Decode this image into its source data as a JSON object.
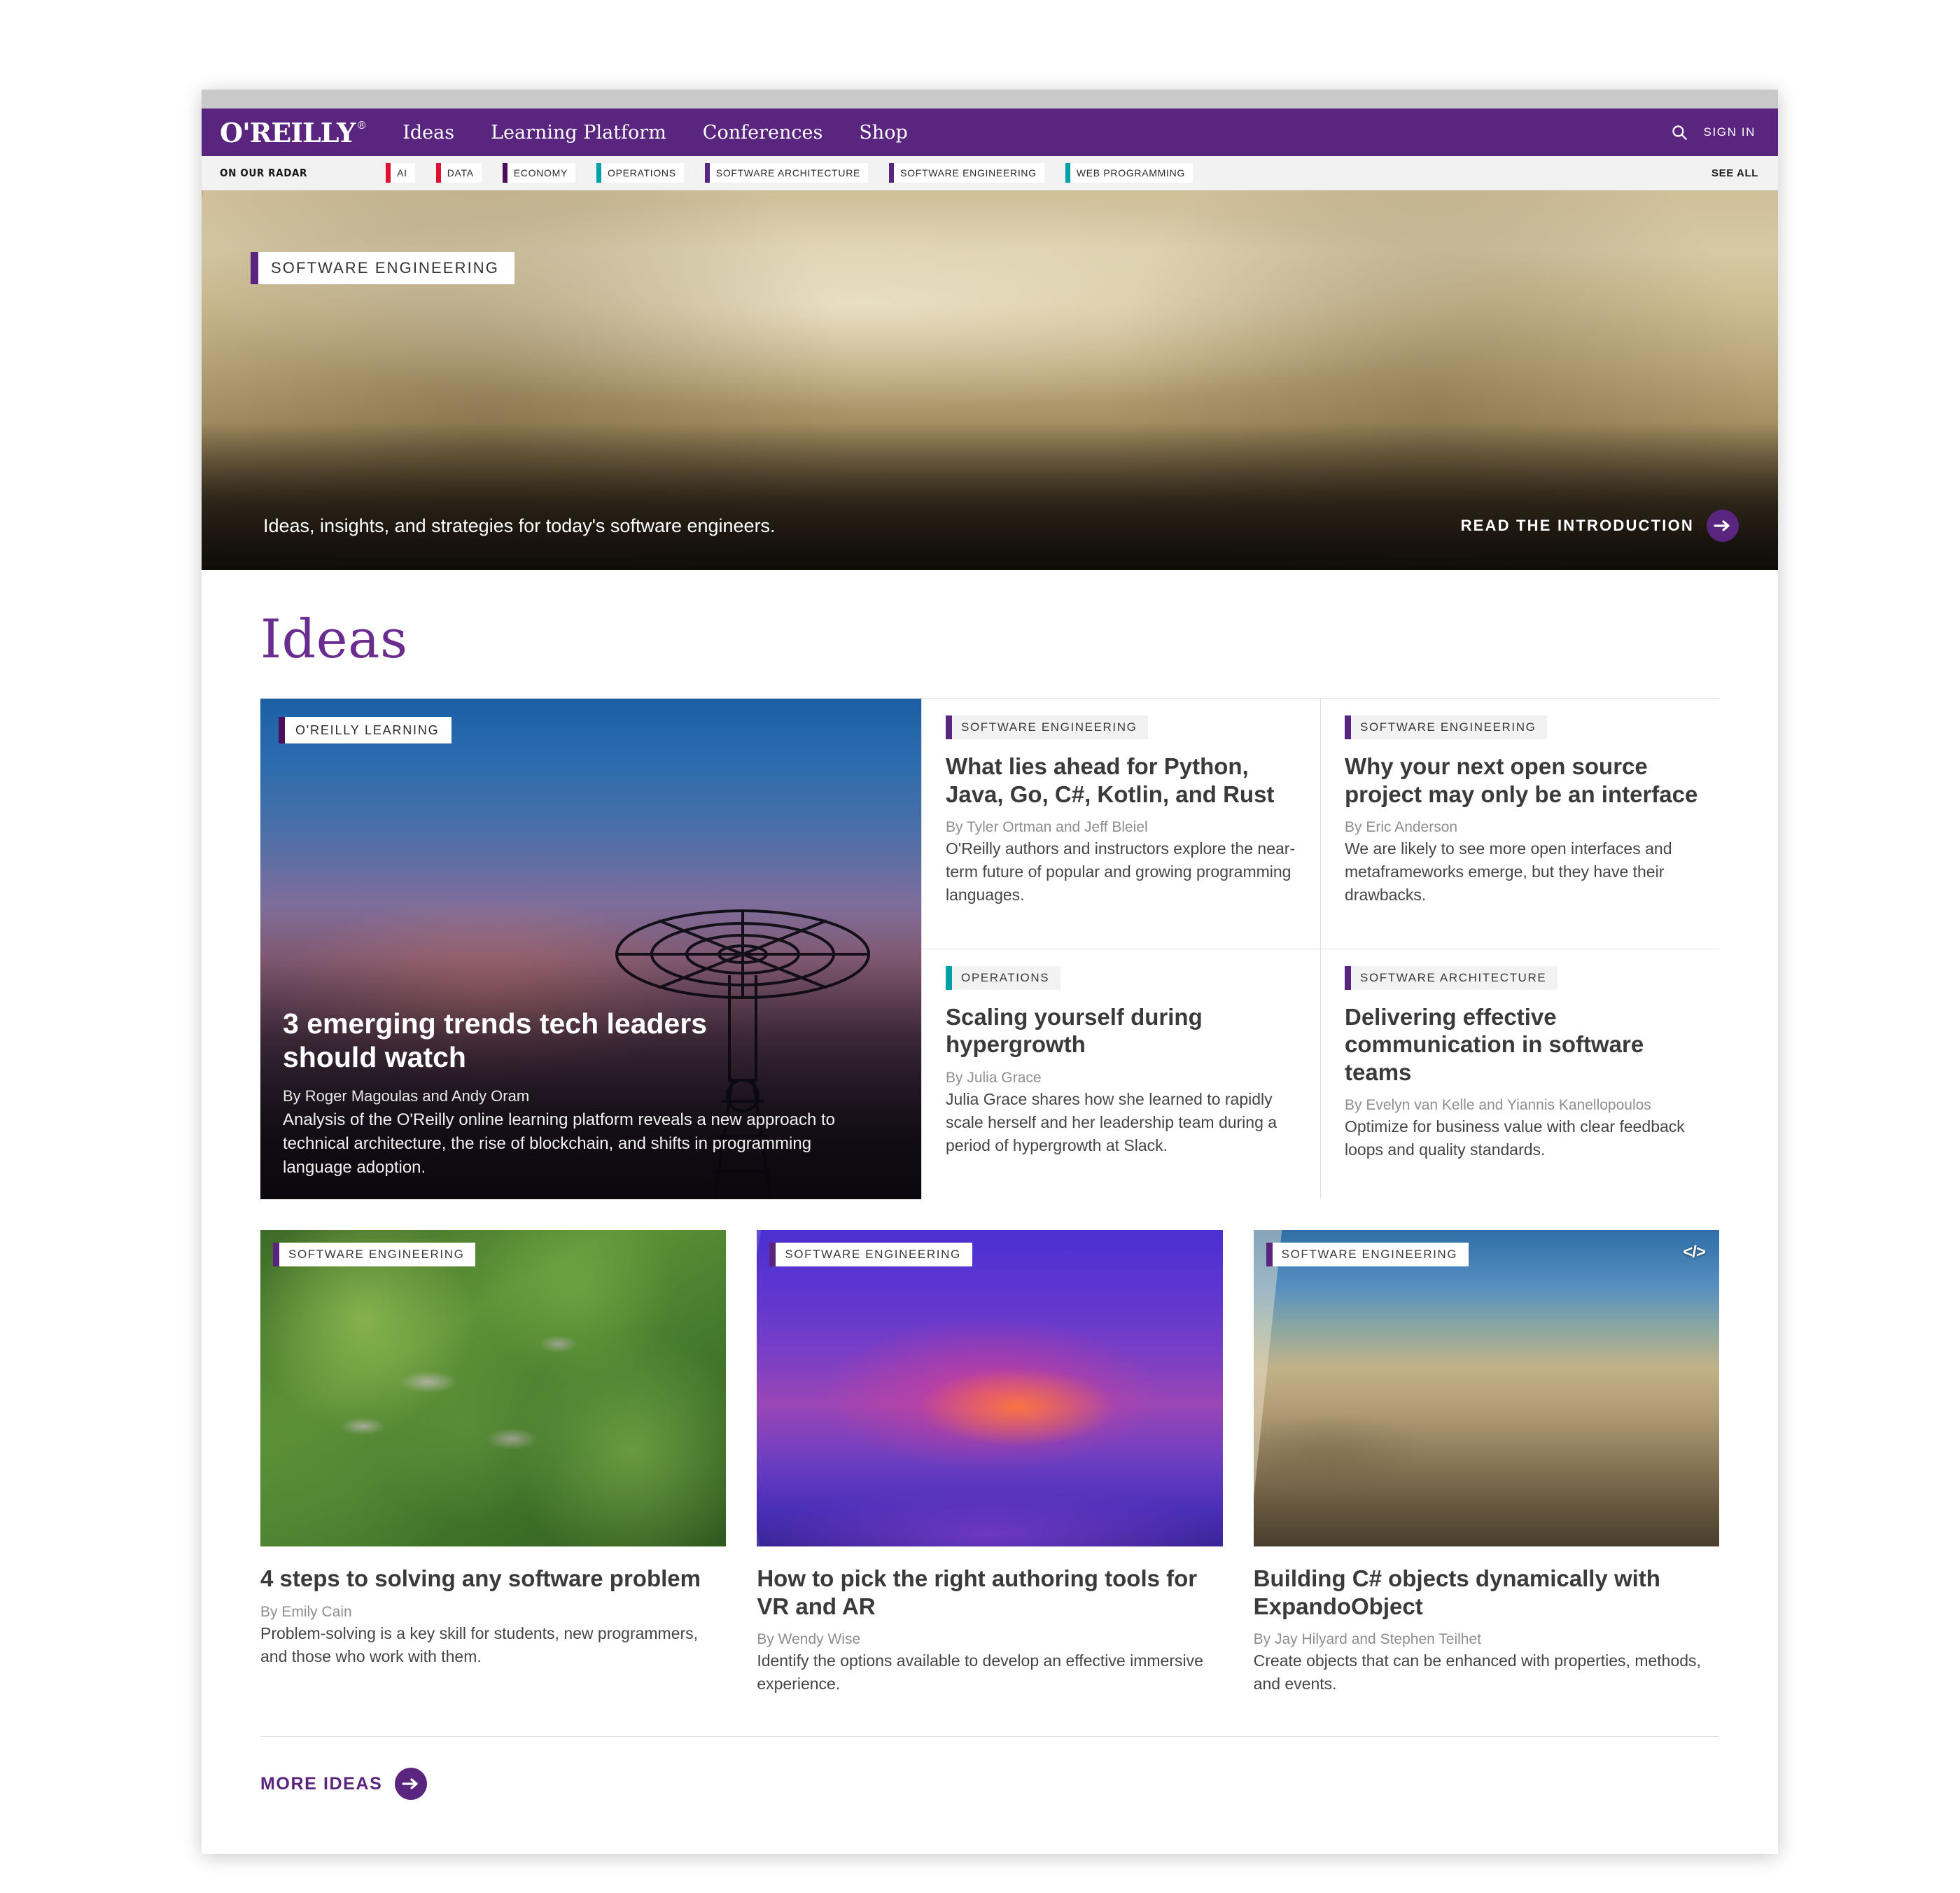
{
  "colors": {
    "brand_purple": "#59257f",
    "tag_ai": "#e01030",
    "tag_data": "#e01030",
    "tag_economy": "#4b1059",
    "tag_operations": "#00a0a8",
    "tag_software_architecture": "#59257f",
    "tag_software_engineering": "#59257f",
    "tag_web_programming": "#00a0a8"
  },
  "nav": {
    "brand": "O'REILLY",
    "brand_reg": "®",
    "links": [
      {
        "label": "Ideas"
      },
      {
        "label": "Learning Platform"
      },
      {
        "label": "Conferences"
      },
      {
        "label": "Shop"
      }
    ],
    "search_icon": "search-icon",
    "signin": "SIGN IN"
  },
  "radar": {
    "label": "ON OUR RADAR",
    "see_all": "SEE ALL",
    "items": [
      {
        "label": "AI",
        "color": "#e01030"
      },
      {
        "label": "DATA",
        "color": "#e01030"
      },
      {
        "label": "ECONOMY",
        "color": "#4b1059"
      },
      {
        "label": "OPERATIONS",
        "color": "#00a0a8"
      },
      {
        "label": "SOFTWARE ARCHITECTURE",
        "color": "#59257f"
      },
      {
        "label": "SOFTWARE ENGINEERING",
        "color": "#59257f"
      },
      {
        "label": "WEB PROGRAMMING",
        "color": "#00a0a8"
      }
    ]
  },
  "hero": {
    "tag": "SOFTWARE ENGINEERING",
    "tag_color": "#59257f",
    "subtitle": "Ideas, insights, and strategies for today's software engineers.",
    "cta": "READ THE INTRODUCTION"
  },
  "main": {
    "title": "Ideas",
    "feature": {
      "tag": "O'REILLY LEARNING",
      "tag_color": "#4b1059",
      "title": "3 emerging trends tech leaders should watch",
      "byline": "By Roger Magoulas and Andy Oram",
      "description": "Analysis of the O'Reilly online learning platform reveals a new approach to technical architecture, the rise of blockchain, and shifts in programming language adoption."
    },
    "mini_cards": [
      {
        "tag": "SOFTWARE ENGINEERING",
        "tag_color": "#59257f",
        "title": "What lies ahead for Python, Java, Go, C#, Kotlin, and Rust",
        "byline": "By Tyler Ortman and Jeff Bleiel",
        "description": "O'Reilly authors and instructors explore the near-term future of popular and growing programming languages."
      },
      {
        "tag": "SOFTWARE ENGINEERING",
        "tag_color": "#59257f",
        "title": "Why your next open source project may only be an interface",
        "byline": "By Eric Anderson",
        "description": "We are likely to see more open interfaces and metaframeworks emerge, but they have their drawbacks."
      },
      {
        "tag": "OPERATIONS",
        "tag_color": "#00a0a8",
        "title": "Scaling yourself during hypergrowth",
        "byline": "By Julia Grace",
        "description": "Julia Grace shares how she learned to rapidly scale herself and her leadership team during a period of hypergrowth at Slack."
      },
      {
        "tag": "SOFTWARE ARCHITECTURE",
        "tag_color": "#59257f",
        "title": "Delivering effective communication in software teams",
        "byline": "By Evelyn van Kelle and Yiannis Kanellopoulos",
        "description": "Optimize for business value with clear feedback loops and quality standards."
      }
    ],
    "bottom_cards": [
      {
        "tag": "SOFTWARE ENGINEERING",
        "tag_color": "#59257f",
        "title": "4 steps to solving any software problem",
        "byline": "By Emily Cain",
        "description": "Problem-solving is a key skill for students, new programmers, and those who work with them.",
        "code_badge": ""
      },
      {
        "tag": "SOFTWARE ENGINEERING",
        "tag_color": "#59257f",
        "title": "How to pick the right authoring tools for VR and AR",
        "byline": "By Wendy Wise",
        "description": "Identify the options available to develop an effective immersive experience.",
        "code_badge": ""
      },
      {
        "tag": "SOFTWARE ENGINEERING",
        "tag_color": "#59257f",
        "title": "Building C# objects dynamically with ExpandoObject",
        "byline": "By Jay Hilyard and Stephen Teilhet",
        "description": "Create objects that can be enhanced with properties, methods, and events.",
        "code_badge": "</>"
      }
    ],
    "more_link": "MORE IDEAS"
  }
}
